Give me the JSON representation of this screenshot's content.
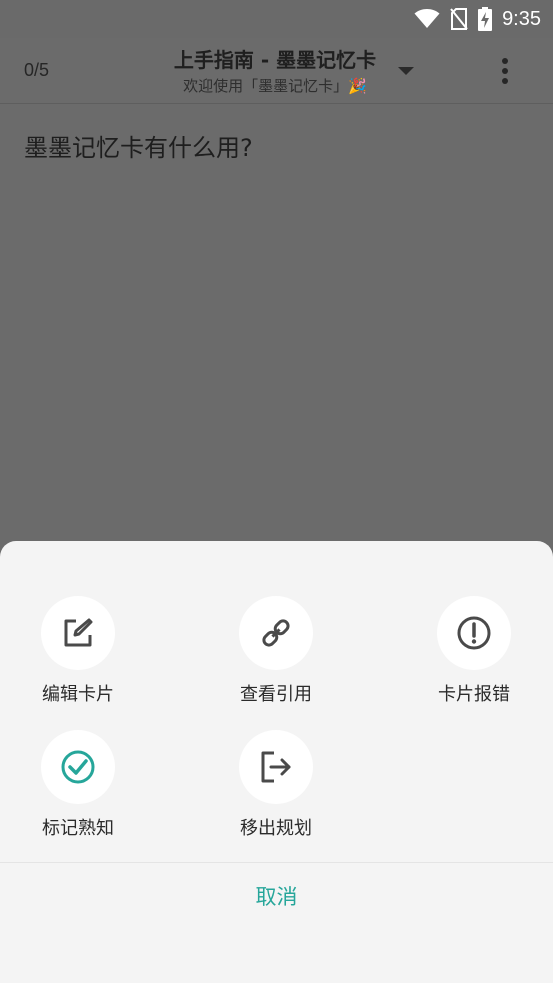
{
  "status_bar": {
    "time": "9:35",
    "icons": [
      "wifi-icon",
      "no-sim-icon",
      "battery-charging-icon"
    ]
  },
  "header": {
    "counter": "0/5",
    "title": "上手指南 - 墨墨记忆卡",
    "subtitle": "欢迎使用「墨墨记忆卡」🎉",
    "dropdown_icon": "caret-down-icon",
    "menu_icon": "more-vert-icon"
  },
  "card": {
    "question": "墨墨记忆卡有什么用?"
  },
  "sheet": {
    "actions": [
      {
        "label": "编辑卡片",
        "icon": "edit-icon"
      },
      {
        "label": "查看引用",
        "icon": "link-icon"
      },
      {
        "label": "卡片报错",
        "icon": "alert-circle-icon"
      },
      {
        "label": "标记熟知",
        "icon": "check-circle-icon"
      },
      {
        "label": "移出规划",
        "icon": "exit-icon"
      }
    ],
    "cancel_label": "取消"
  },
  "colors": {
    "accent": "#26a69a",
    "overlay": "#6b6b6b",
    "sheet_bg": "#f4f4f4"
  }
}
